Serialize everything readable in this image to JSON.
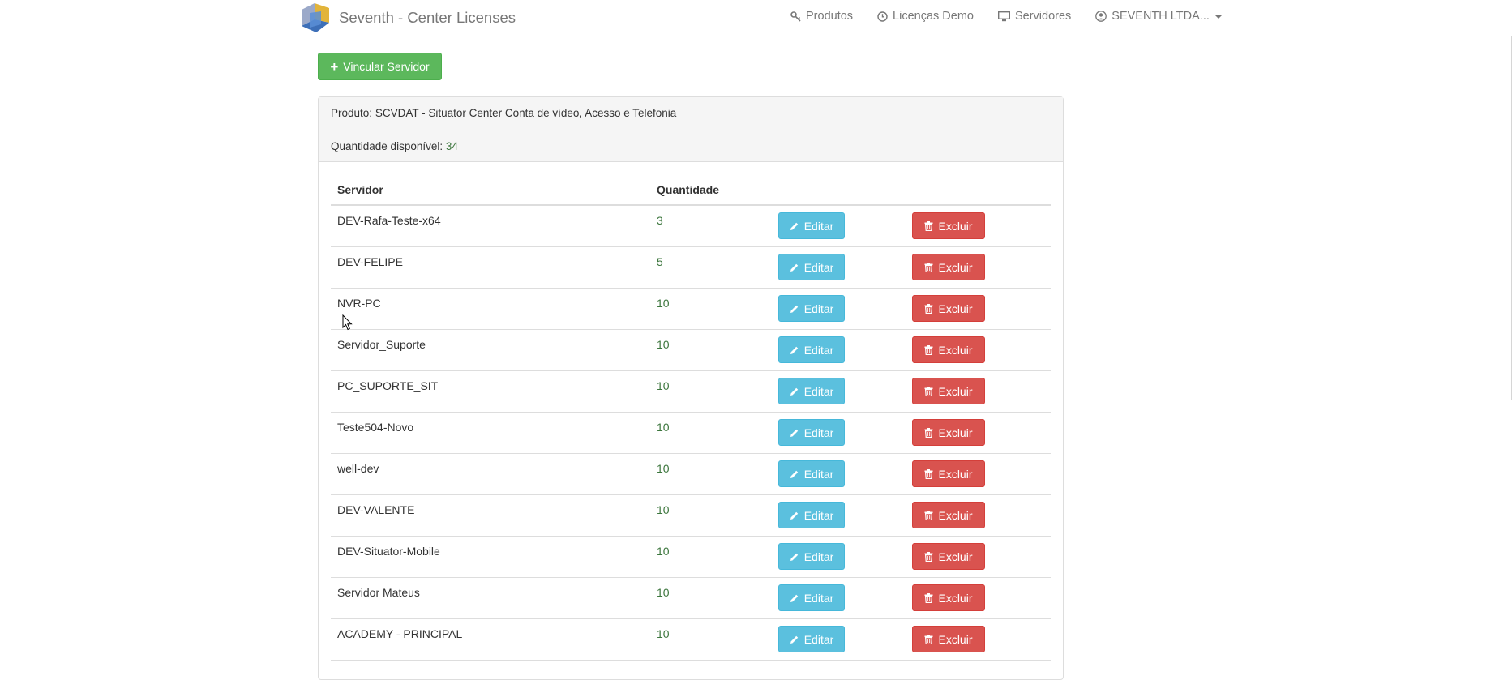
{
  "navbar": {
    "brand": "Seventh - Center Licenses",
    "items": [
      {
        "label": "Produtos",
        "icon": "key-icon"
      },
      {
        "label": "Licenças Demo",
        "icon": "clock-icon"
      },
      {
        "label": "Servidores",
        "icon": "monitor-icon"
      },
      {
        "label": "SEVENTH LTDA...",
        "icon": "user-circle-icon"
      }
    ]
  },
  "actions": {
    "add_server": "Vincular Servidor"
  },
  "panel": {
    "product_label": "Produto:",
    "product_value": "SCVDAT - Situator Center Conta de vídeo, Acesso e Telefonia",
    "available_label": "Quantidade disponível:",
    "available_value": "34"
  },
  "table": {
    "headers": {
      "server": "Servidor",
      "quantity": "Quantidade"
    },
    "edit_label": "Editar",
    "delete_label": "Excluir",
    "rows": [
      {
        "server": "DEV-Rafa-Teste-x64",
        "quantity": "3"
      },
      {
        "server": "DEV-FELIPE",
        "quantity": "5"
      },
      {
        "server": "NVR-PC",
        "quantity": "10"
      },
      {
        "server": "Servidor_Suporte",
        "quantity": "10"
      },
      {
        "server": "PC_SUPORTE_SIT",
        "quantity": "10"
      },
      {
        "server": "Teste504-Novo",
        "quantity": "10"
      },
      {
        "server": "well-dev",
        "quantity": "10"
      },
      {
        "server": "DEV-VALENTE",
        "quantity": "10"
      },
      {
        "server": "DEV-Situator-Mobile",
        "quantity": "10"
      },
      {
        "server": "Servidor Mateus",
        "quantity": "10"
      },
      {
        "server": "ACADEMY - PRINCIPAL",
        "quantity": "10"
      }
    ]
  },
  "colors": {
    "success": "#5cb85c",
    "info": "#5bc0de",
    "danger": "#d9534f",
    "quantity_text": "#3c763d"
  }
}
